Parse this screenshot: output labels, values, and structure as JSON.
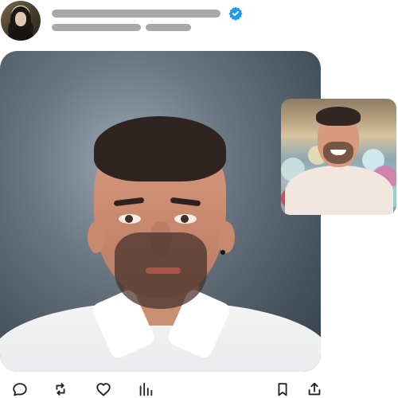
{
  "post": {
    "verified_color": "#1d9bf0",
    "avatar_icon": "avatar-photo",
    "verified_icon": "verified-badge-icon",
    "main_media_icon": "portrait-photo",
    "inset_media_icon": "party-photo"
  },
  "actions": {
    "reply": {
      "icon": "reply-icon"
    },
    "retweet": {
      "icon": "retweet-icon"
    },
    "like": {
      "icon": "heart-icon"
    },
    "stats": {
      "icon": "stats-icon"
    },
    "bookmark": {
      "icon": "bookmark-icon"
    },
    "share": {
      "icon": "share-icon"
    }
  }
}
